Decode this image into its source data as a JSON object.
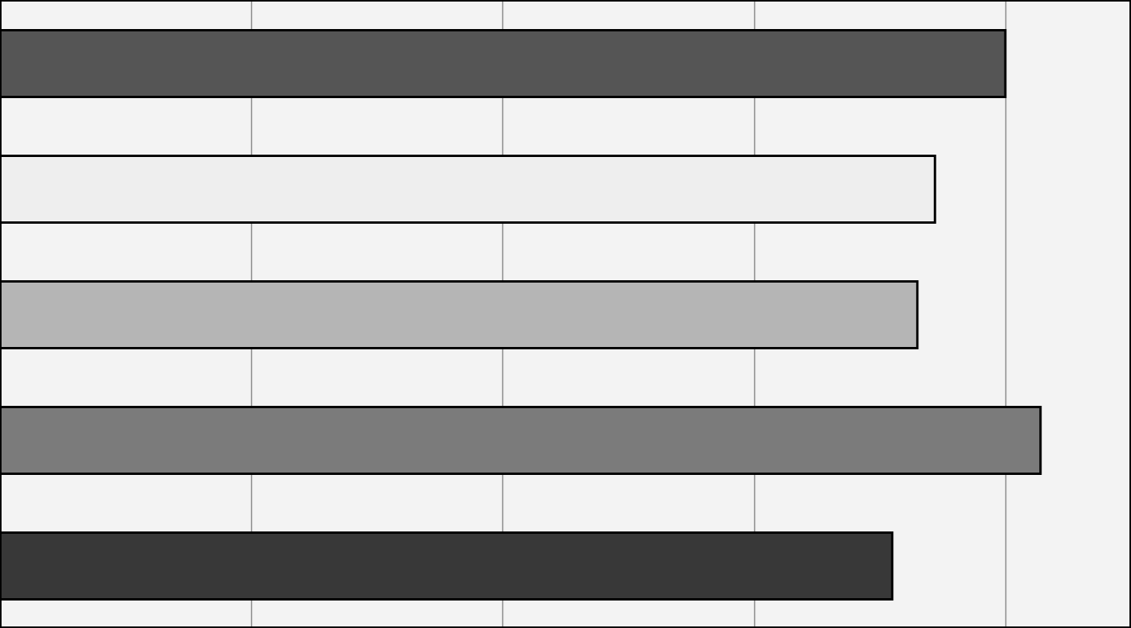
{
  "chart_data": {
    "type": "bar",
    "orientation": "horizontal",
    "title": "",
    "xlabel": "",
    "ylabel": "",
    "xlim": [
      0,
      4.5
    ],
    "grid": true,
    "grid_interval": 1,
    "legend": "none",
    "background_color": "#f3f3f3",
    "gridline_color": "#8a8a8a",
    "bar_outline_color": "#000000",
    "categories": [
      "",
      "",
      "",
      "",
      ""
    ],
    "values": [
      4.0,
      3.72,
      3.65,
      4.14,
      3.55
    ],
    "colors": [
      "#555555",
      "#eeeeee",
      "#b5b5b5",
      "#7b7b7b",
      "#383838"
    ]
  }
}
